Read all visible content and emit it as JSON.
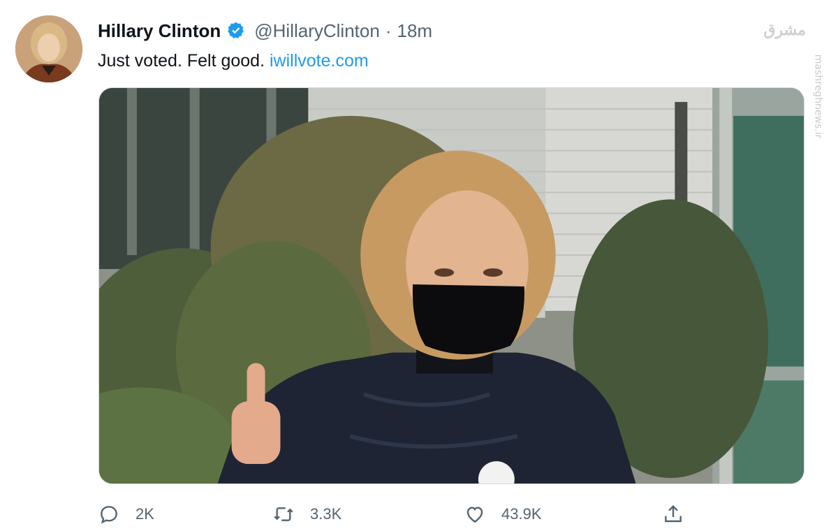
{
  "tweet": {
    "author_name": "Hillary Clinton",
    "handle": "@HillaryClinton",
    "separator": "·",
    "time": "18m",
    "text": "Just voted. Felt good.",
    "link": "iwillvote.com"
  },
  "actions": {
    "replies": "2K",
    "retweets": "3.3K",
    "likes": "43.9K"
  },
  "watermark": {
    "logo": "مشرق",
    "site": "mashreghnews.ir"
  },
  "colors": {
    "accent": "#1d9bf0",
    "secondary_text": "#536471",
    "primary_text": "#0f1419"
  },
  "icons": [
    "verified-badge-icon",
    "reply-icon",
    "retweet-icon",
    "like-icon",
    "share-icon"
  ]
}
